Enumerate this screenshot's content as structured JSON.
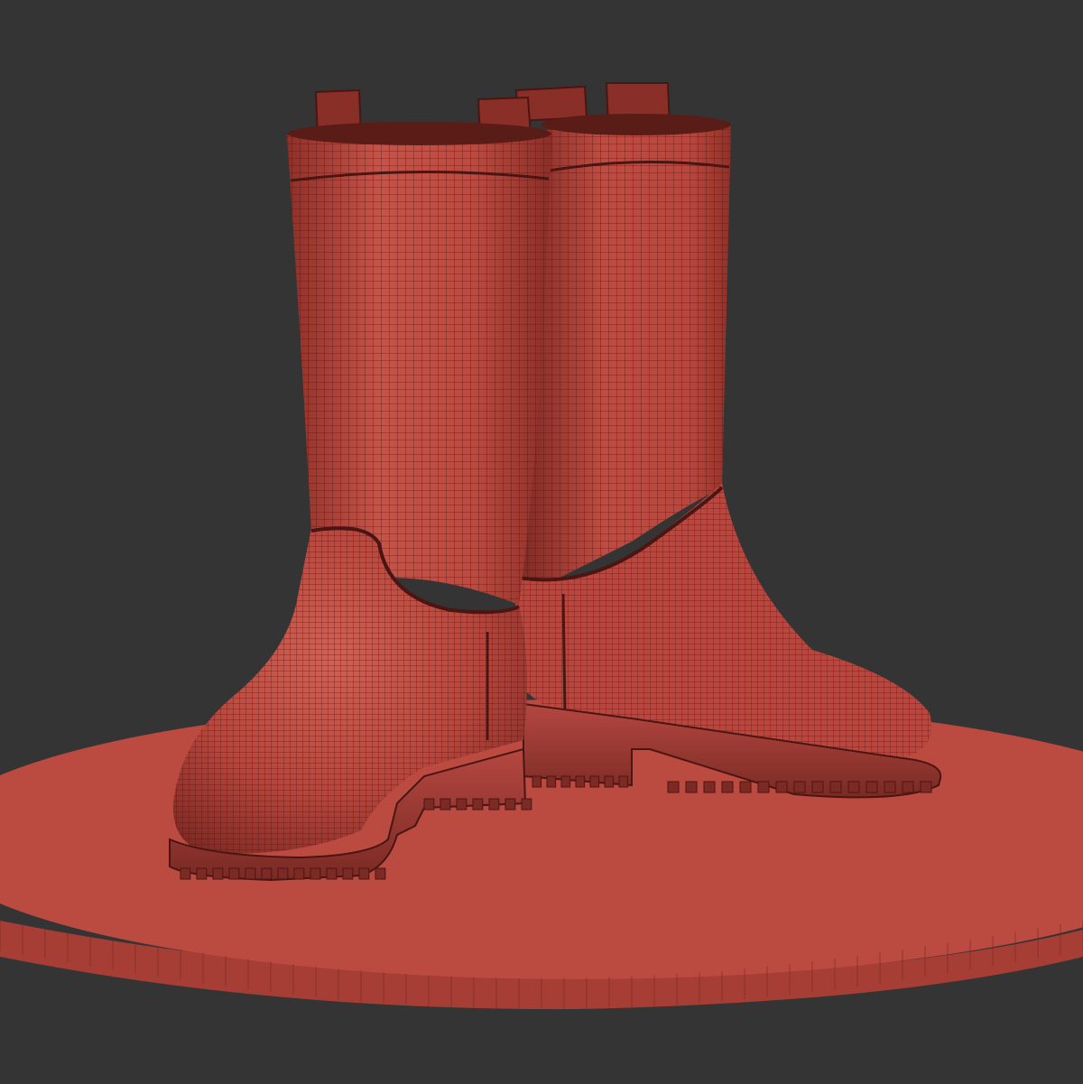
{
  "scene": {
    "background_color": "#343434",
    "subject": "wireframe-render-rain-boots",
    "colors": {
      "boot_base": "#b8483f",
      "boot_light": "#c95a4f",
      "boot_dark": "#7d2a24",
      "wire": "#4a1512",
      "pedestal_top": "#bb4a40",
      "pedestal_edge": "#a63e36",
      "pedestal_wire": "#6e2620"
    },
    "pedestal": {
      "shape": "ellipse-disc",
      "edge_segments": 48
    },
    "objects": [
      {
        "name": "left-boot",
        "position": "front-left"
      },
      {
        "name": "right-boot",
        "position": "back-right"
      }
    ]
  }
}
